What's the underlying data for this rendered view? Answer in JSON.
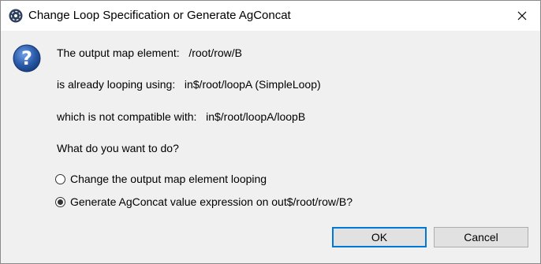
{
  "window": {
    "title": "Change Loop Specification or Generate AgConcat",
    "app_icon": "talend-icon",
    "close_icon": "close-icon"
  },
  "message": {
    "icon": "question-icon",
    "line1": "The output map element:   /root/row/B",
    "line2": "is already looping using:   in$/root/loopA (SimpleLoop)",
    "line3": "which is not compatible with:   in$/root/loopA/loopB",
    "question": "What do you want to do?"
  },
  "options": [
    {
      "label": "Change the output map element looping",
      "checked": false
    },
    {
      "label": "Generate AgConcat value expression on out$/root/row/B?",
      "checked": true
    }
  ],
  "buttons": {
    "ok": "OK",
    "cancel": "Cancel"
  },
  "colors": {
    "accent": "#0078d7",
    "question_icon": "#2a5aa8",
    "dialog_bg": "#f0f0f0"
  }
}
